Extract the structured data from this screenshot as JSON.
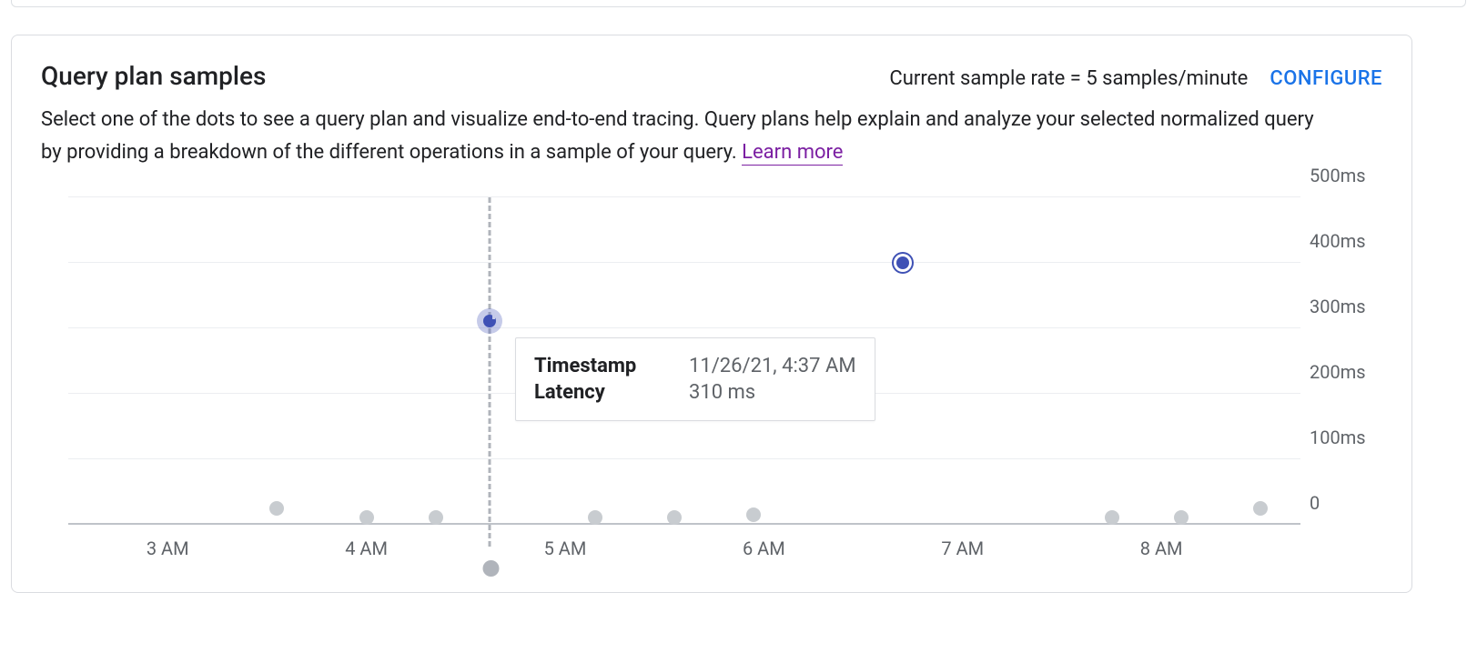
{
  "card": {
    "title": "Query plan samples",
    "sample_rate_text": "Current sample rate = 5 samples/minute",
    "configure_label": "CONFIGURE",
    "description_prefix": "Select one of the dots to see a query plan and visualize end-to-end tracing. Query plans help explain and analyze your selected normalized query by providing a breakdown of the different operations in a sample of your query. ",
    "learn_more_label": "Learn more"
  },
  "tooltip": {
    "timestamp_label": "Timestamp",
    "timestamp_value": "11/26/21, 4:37 AM",
    "latency_label": "Latency",
    "latency_value": "310 ms"
  },
  "chart_data": {
    "type": "scatter",
    "title": "",
    "xlabel": "",
    "ylabel": "",
    "x_unit": "hour (AM)",
    "y_unit": "ms",
    "xlim": [
      2.5,
      8.7
    ],
    "ylim": [
      0,
      500
    ],
    "x_ticks": [
      3,
      4,
      5,
      6,
      7,
      8
    ],
    "x_tick_labels": [
      "3 AM",
      "4 AM",
      "5 AM",
      "6 AM",
      "7 AM",
      "8 AM"
    ],
    "y_ticks": [
      0,
      100,
      200,
      300,
      400,
      500
    ],
    "y_tick_labels": [
      "0",
      "100ms",
      "200ms",
      "300ms",
      "400ms",
      "500ms"
    ],
    "series": [
      {
        "name": "query-plan-samples",
        "points": [
          {
            "x": 3.55,
            "y": 25,
            "state": "normal"
          },
          {
            "x": 4.0,
            "y": 10,
            "state": "normal"
          },
          {
            "x": 4.35,
            "y": 10,
            "state": "normal"
          },
          {
            "x": 4.62,
            "y": 310,
            "state": "hovered"
          },
          {
            "x": 5.15,
            "y": 10,
            "state": "normal"
          },
          {
            "x": 5.55,
            "y": 10,
            "state": "normal"
          },
          {
            "x": 5.95,
            "y": 15,
            "state": "normal"
          },
          {
            "x": 6.7,
            "y": 400,
            "state": "selected"
          },
          {
            "x": 7.75,
            "y": 10,
            "state": "normal"
          },
          {
            "x": 8.1,
            "y": 10,
            "state": "normal"
          },
          {
            "x": 8.5,
            "y": 25,
            "state": "normal"
          }
        ]
      }
    ],
    "crosshair_x": 4.62
  }
}
